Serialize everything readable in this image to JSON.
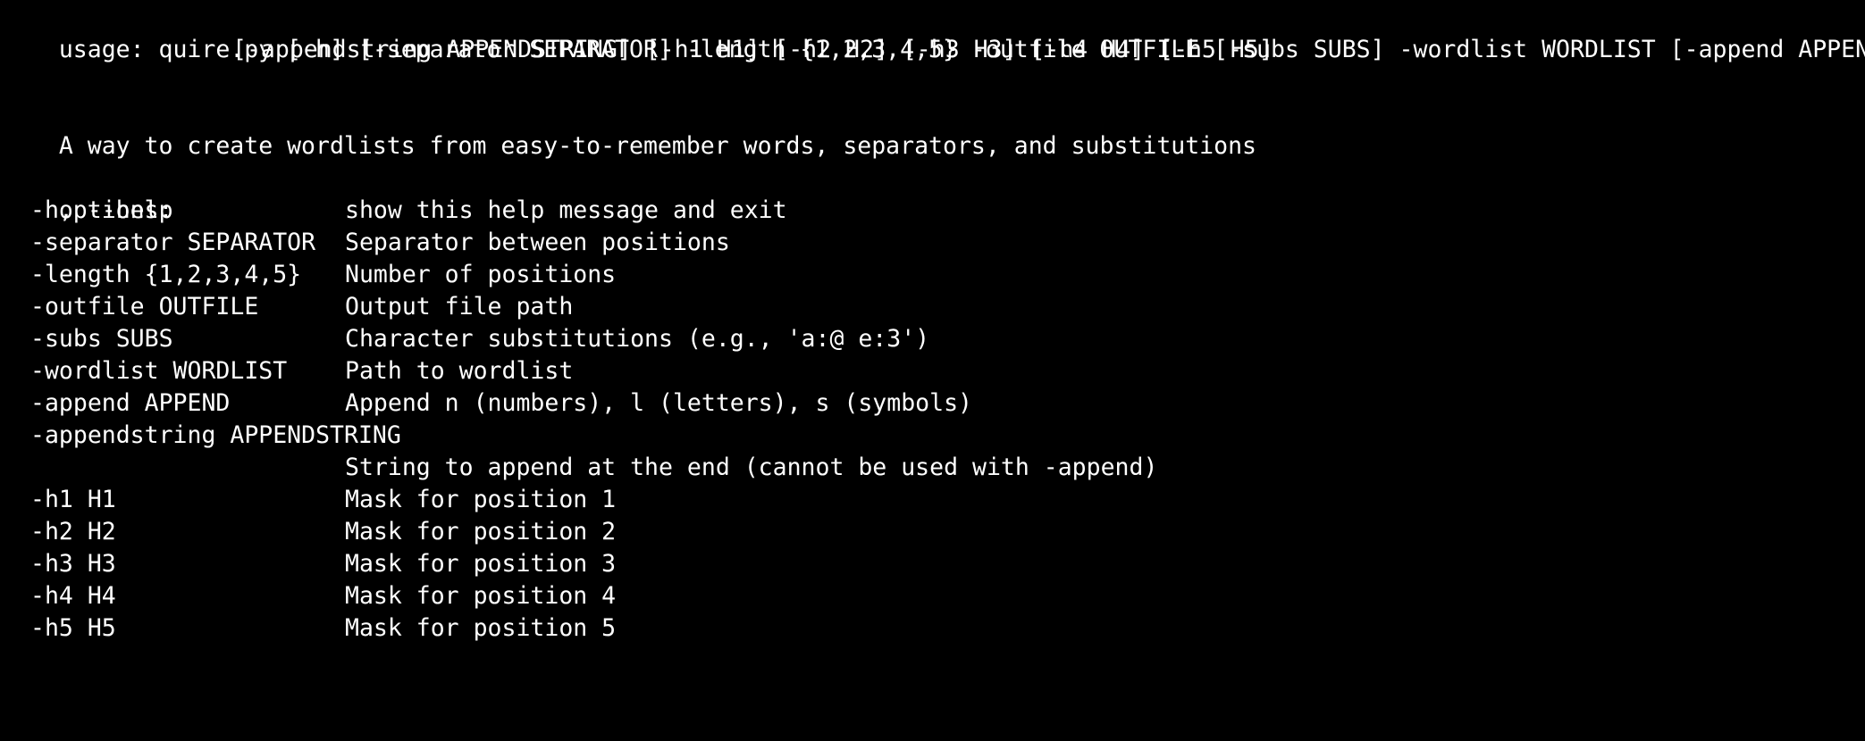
{
  "colors": {
    "background": "#000000",
    "foreground": "#ffffff"
  },
  "usage": {
    "line1": "usage: quire.py [-h] [-separator SEPARATOR] -length {1,2,3,4,5} -outfile OUTFILE [-subs SUBS] -wordlist WORDLIST [-append APPEND]",
    "line2": "[-appendstring APPENDSTRING] [-h1 H1] [-h2 H2] [-h3 H3] [-h4 H4] [-h5 H5]"
  },
  "description": "A way to create wordlists from easy-to-remember words, separators, and substitutions",
  "options_heading": "options:",
  "options": [
    {
      "flag": "-h, --help",
      "help": "show this help message and exit"
    },
    {
      "flag": "-separator SEPARATOR",
      "help": "Separator between positions"
    },
    {
      "flag": "-length {1,2,3,4,5}",
      "help": "Number of positions"
    },
    {
      "flag": "-outfile OUTFILE",
      "help": "Output file path"
    },
    {
      "flag": "-subs SUBS",
      "help": "Character substitutions (e.g., 'a:@ e:3')"
    },
    {
      "flag": "-wordlist WORDLIST",
      "help": "Path to wordlist"
    },
    {
      "flag": "-append APPEND",
      "help": "Append n (numbers), l (letters), s (symbols)"
    },
    {
      "flag": "-appendstring APPENDSTRING",
      "help": ""
    },
    {
      "flag": "",
      "help": "String to append at the end (cannot be used with -append)"
    },
    {
      "flag": "-h1 H1",
      "help": "Mask for position 1"
    },
    {
      "flag": "-h2 H2",
      "help": "Mask for position 2"
    },
    {
      "flag": "-h3 H3",
      "help": "Mask for position 3"
    },
    {
      "flag": "-h4 H4",
      "help": "Mask for position 4"
    },
    {
      "flag": "-h5 H5",
      "help": "Mask for position 5"
    }
  ]
}
